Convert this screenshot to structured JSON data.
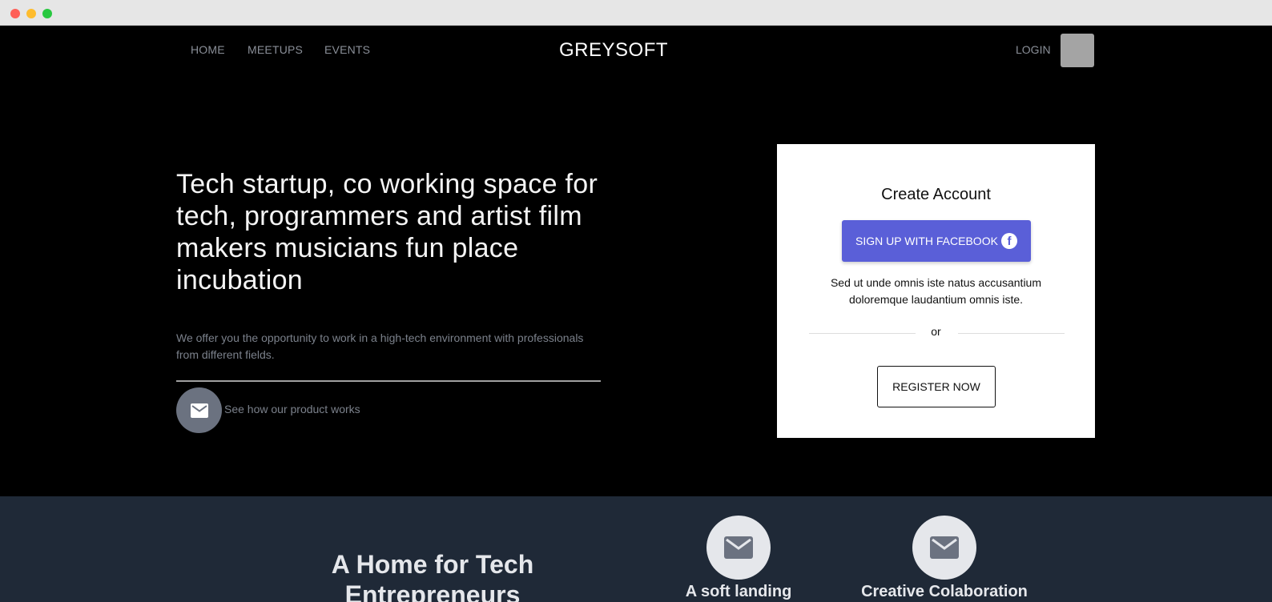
{
  "nav": {
    "home": "HOME",
    "meetups": "MEETUPS",
    "events": "EVENTS",
    "brand": "GREYSOFT",
    "login": "LOGIN"
  },
  "hero": {
    "title": "Tech startup, co working space for tech, programmers and artist film makers musicians fun place incubation",
    "description": "We offer you the opportunity to work in a high-tech environment with professionals from different fields.",
    "video_link": "See how our product works"
  },
  "signup": {
    "title": "Create Account",
    "facebook_button": "SIGN UP WITH FACEBOOK",
    "text": "Sed ut unde omnis iste natus accusantium doloremque laudantium omnis iste.",
    "or": "or",
    "register_button": "REGISTER NOW"
  },
  "features": {
    "title": "A Home for Tech Entrepreneurs",
    "items": [
      {
        "label": "A soft landing",
        "icon": "mail-icon"
      },
      {
        "label": "Creative Colaboration",
        "icon": "mail-icon"
      }
    ]
  },
  "colors": {
    "accent": "#5a5fd8",
    "lower_bg": "#1f2937"
  }
}
